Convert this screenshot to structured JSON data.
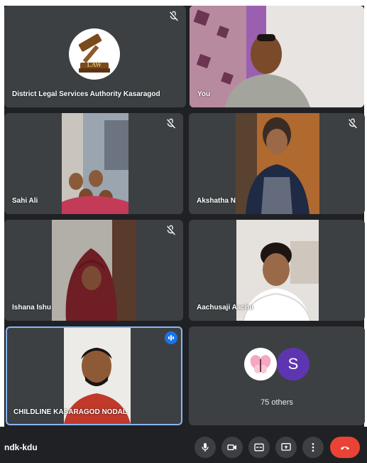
{
  "participants": [
    {
      "name": "District Legal Services Authority Kasaragod",
      "muted": true,
      "logo_text": "LAW"
    },
    {
      "name": "You",
      "muted": false
    },
    {
      "name": "Sahi Ali",
      "muted": true
    },
    {
      "name": "Akshatha N",
      "muted": true
    },
    {
      "name": "Ishana Ishu",
      "muted": true
    },
    {
      "name": "Aachusaji Aachu",
      "muted": false
    },
    {
      "name": "CHILDLINE KASARAGOD NODAL",
      "muted": false,
      "speaking": true
    }
  ],
  "others": {
    "count_label": "75 others",
    "avatar_letter": "S"
  },
  "bottom_bar": {
    "meeting_code": "ndk-kdu"
  },
  "icons": {
    "mute": "mic-off-icon",
    "speaking": "audio-level-icon",
    "controls": [
      "mic-icon",
      "camera-icon",
      "captions-icon",
      "present-icon",
      "more-vert-icon",
      "call-end-icon"
    ]
  },
  "colors": {
    "background": "#202124",
    "tile": "#3c4043",
    "active_border": "#8ab4f8",
    "end_call": "#ea4335",
    "avatar_purple": "#5e35b1",
    "speaking_blue": "#1a73e8"
  }
}
